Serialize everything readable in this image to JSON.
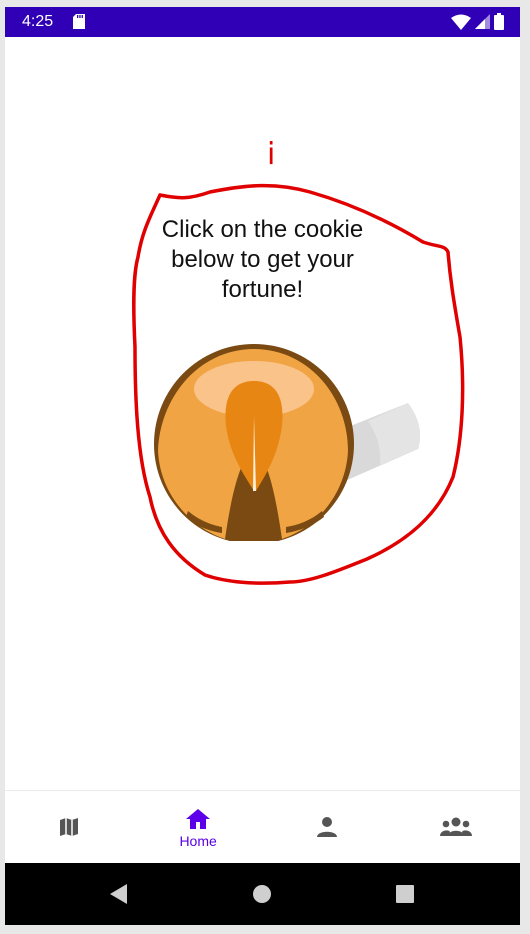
{
  "status_bar": {
    "time": "4:25",
    "background_color": "#2f00b5",
    "icons": [
      "sd-card-icon",
      "wifi-icon",
      "cell-signal-icon",
      "battery-icon"
    ]
  },
  "main": {
    "marker_text": "i",
    "prompt_text": "Click on the cookie below to get your fortune!",
    "cookie_image": "fortune-cookie-image",
    "annotation_color": "#e00000"
  },
  "bottom_nav": {
    "accent_color": "#5b00e8",
    "items": [
      {
        "icon": "map-icon",
        "label": "",
        "selected": false
      },
      {
        "icon": "home-icon",
        "label": "Home",
        "selected": true
      },
      {
        "icon": "person-icon",
        "label": "",
        "selected": false
      },
      {
        "icon": "group-icon",
        "label": "",
        "selected": false
      }
    ]
  },
  "system_nav": {
    "buttons": [
      "back-icon",
      "home-circle-icon",
      "recents-icon"
    ]
  }
}
